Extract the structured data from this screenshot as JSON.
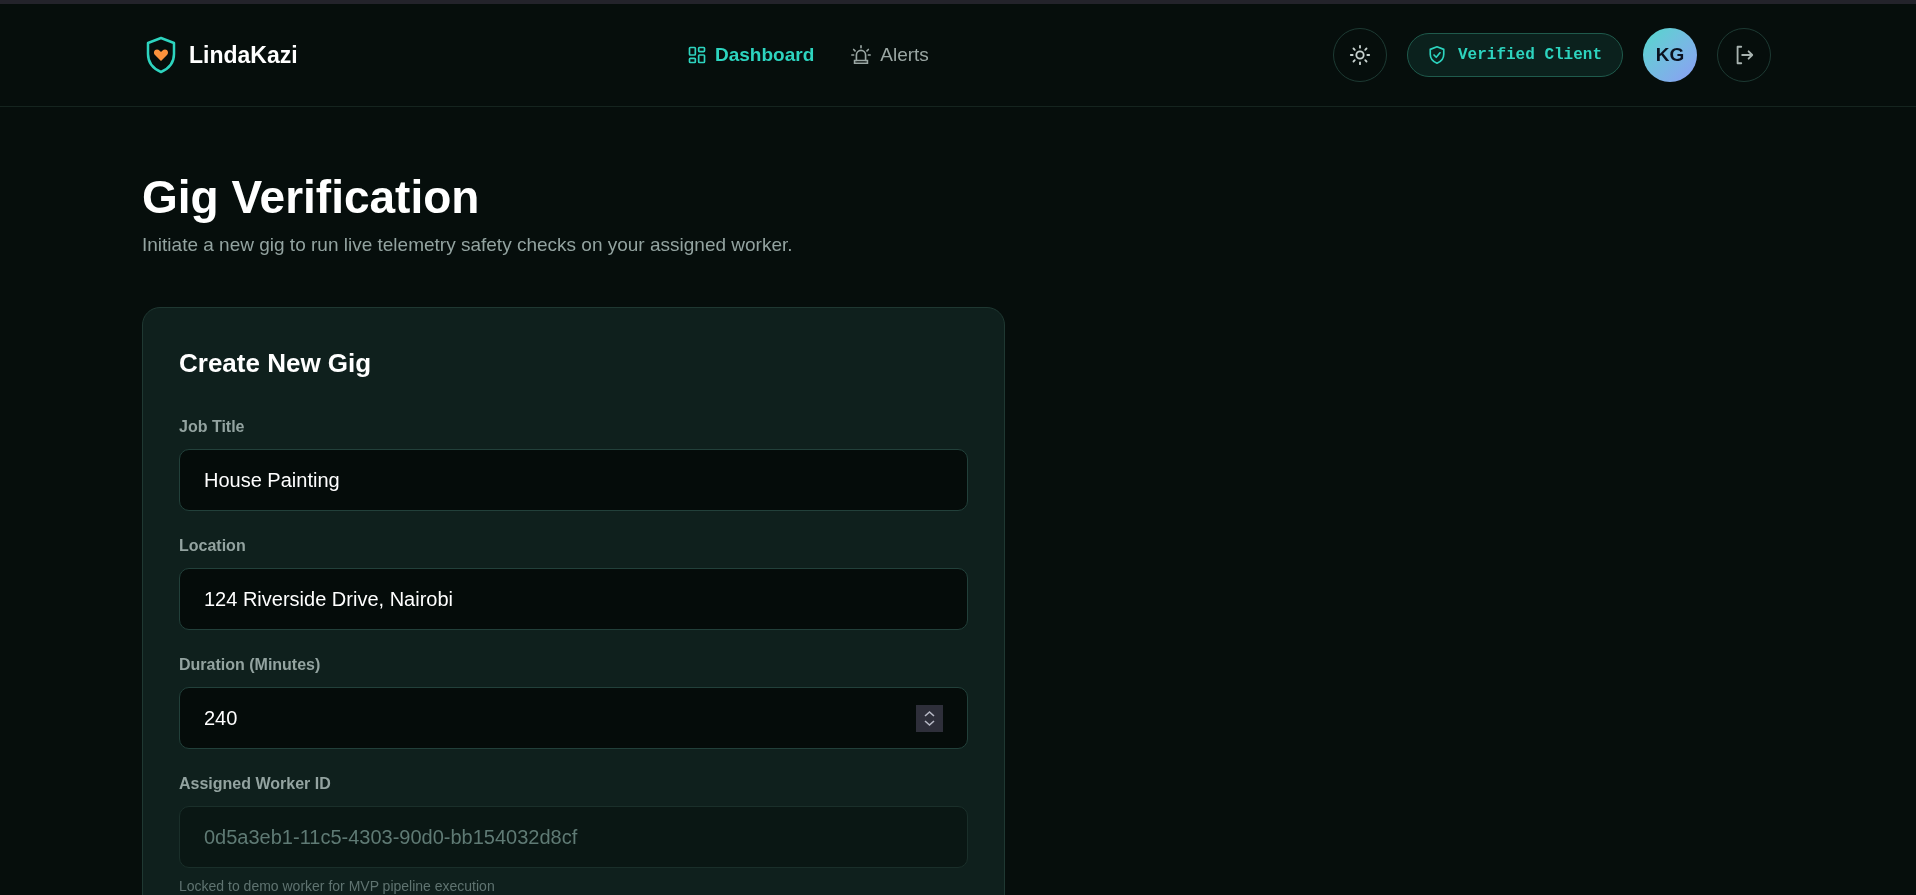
{
  "brand": {
    "name": "LindaKazi"
  },
  "nav": [
    {
      "label": "Dashboard",
      "selected": true
    },
    {
      "label": "Alerts",
      "selected": false
    }
  ],
  "badge": {
    "label": "Verified Client"
  },
  "avatar": {
    "initials": "KG"
  },
  "page": {
    "title": "Gig Verification",
    "subtitle": "Initiate a new gig to run live telemetry safety checks on your assigned worker."
  },
  "form": {
    "title": "Create New Gig",
    "fields": [
      {
        "label": "Job Title",
        "kind": "text",
        "value": "House Painting",
        "disabled": false
      },
      {
        "label": "Location",
        "kind": "text",
        "value": "124 Riverside Drive, Nairobi",
        "disabled": false
      },
      {
        "label": "Duration (Minutes)",
        "kind": "number",
        "value": "240",
        "disabled": false
      },
      {
        "label": "Assigned Worker ID",
        "kind": "text",
        "value": "0d5a3eb1-11c5-4303-90d0-bb154032d8cf",
        "disabled": true,
        "hint": "Locked to demo worker for MVP pipeline execution"
      }
    ]
  }
}
